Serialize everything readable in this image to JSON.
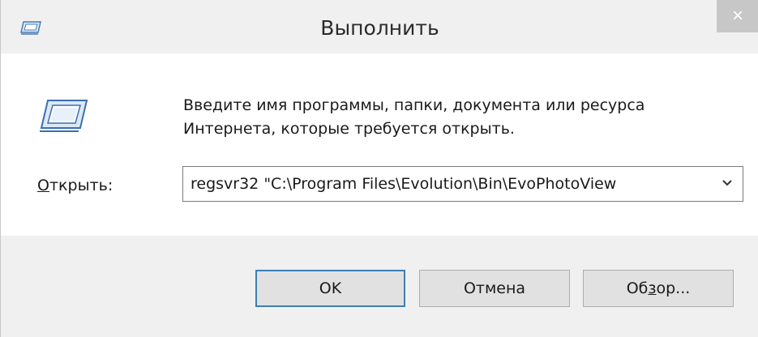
{
  "window": {
    "title": "Выполнить",
    "close_label": "×"
  },
  "content": {
    "description_line1": "Введите имя программы, папки, документа или ресурса",
    "description_line2": "Интернета, которые требуется открыть.",
    "open_label_accel": "О",
    "open_label_rest": "ткрыть:",
    "command_value": "regsvr32  \"C:\\Program Files\\Evolution\\Bin\\EvoPhotoView"
  },
  "buttons": {
    "ok": "OK",
    "cancel": "Отмена",
    "browse_pre": "Об",
    "browse_accel": "з",
    "browse_post": "ор..."
  },
  "colors": {
    "accent_border": "#3c7fb1",
    "icon_blue": "#4a7bb5",
    "close_bg": "#c7c7c7"
  },
  "icons": {
    "title": "run-icon",
    "main": "run-icon",
    "dropdown": "chevron-down-icon",
    "close": "close-icon"
  }
}
